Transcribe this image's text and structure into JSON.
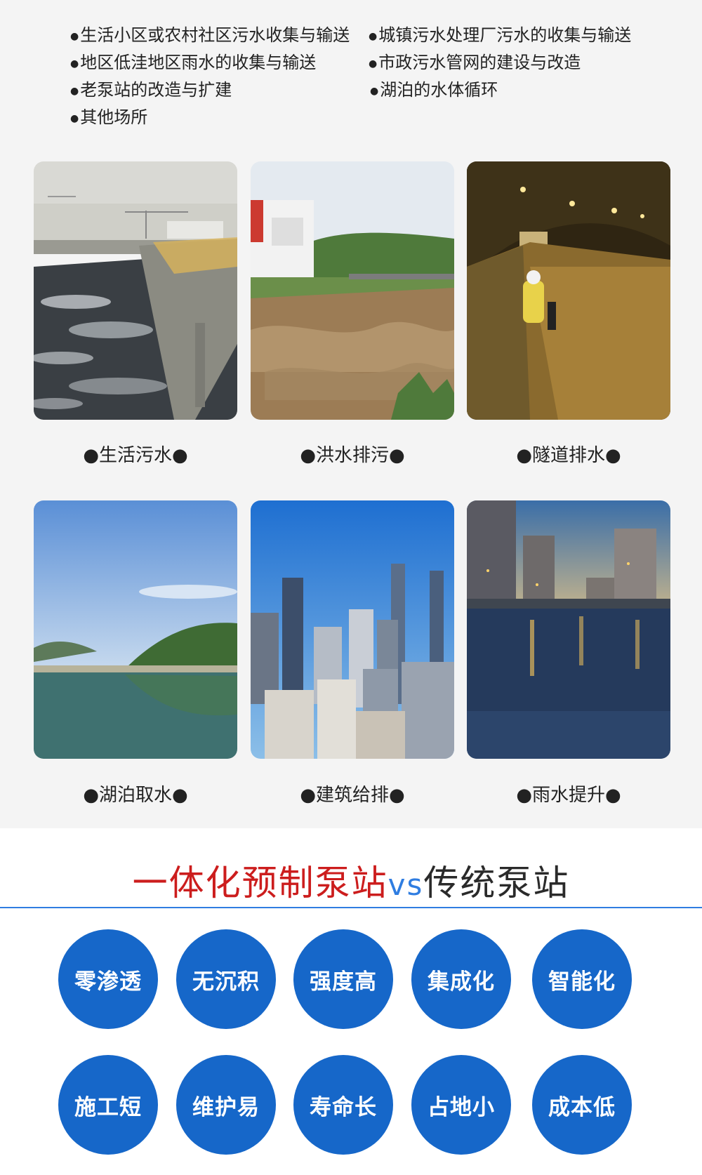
{
  "applications": [
    "生活小区或农村社区污水收集与输送",
    "城镇污水处理厂污水的收集与输送",
    "地区低洼地区雨水的收集与输送",
    "市政污水管网的建设与改造",
    "老泵站的改造与扩建",
    "湖泊的水体循环",
    "其他场所"
  ],
  "scenes": [
    {
      "caption": "●生活污水●",
      "icon": "sewage-treatment-photo"
    },
    {
      "caption": "●洪水排污●",
      "icon": "flood-river-photo"
    },
    {
      "caption": "●隧道排水●",
      "icon": "tunnel-drainage-photo"
    },
    {
      "caption": "●湖泊取水●",
      "icon": "lake-photo"
    },
    {
      "caption": "●建筑给排●",
      "icon": "city-buildings-photo"
    },
    {
      "caption": "●雨水提升●",
      "icon": "rainwater-street-photo"
    }
  ],
  "comparison": {
    "title_part1": "一体化预制泵站",
    "title_vs": "vs",
    "title_part2": "传统泵站",
    "colors": {
      "part1": "#cc1d1d",
      "vs": "#2f7de1",
      "part2": "#2a2a2a",
      "badge": "#1667c9"
    }
  },
  "features": [
    "零渗透",
    "无沉积",
    "强度高",
    "集成化",
    "智能化",
    "施工短",
    "维护易",
    "寿命长",
    "占地小",
    "成本低"
  ]
}
